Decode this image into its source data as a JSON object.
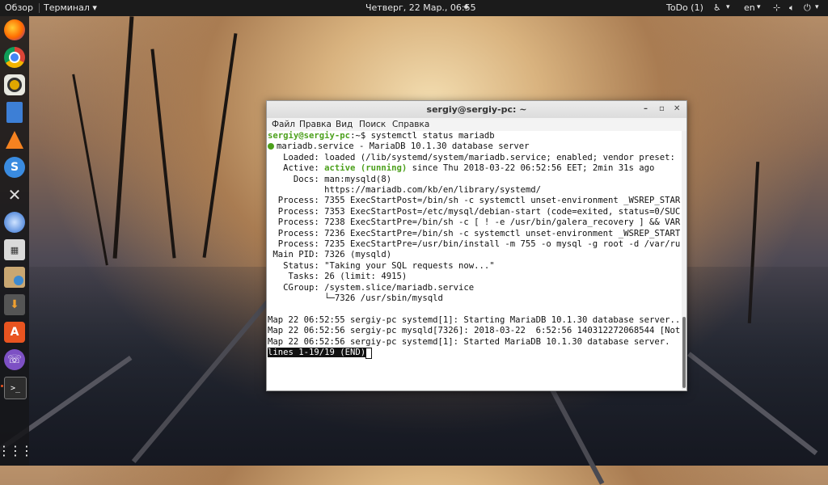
{
  "topbar": {
    "overview": "Обзор",
    "app_menu": "Терминал ▾",
    "clock": "Четверг, 22 Мар., 06:55",
    "todo": "ToDo (1)",
    "lang": "en",
    "lang_arrow": "▾",
    "accessibility_arrow": "▾",
    "net_arrow": "▾",
    "power_arrow": "▾"
  },
  "dock": {
    "icons": [
      "firefox-icon",
      "chrome-icon",
      "rhythmbox-icon",
      "text-editor-icon",
      "vlc-icon",
      "simplenote-icon",
      "tools-icon",
      "thunderbird-icon",
      "calculator-icon",
      "file-manager-icon",
      "installer-icon",
      "app-center-icon",
      "viber-icon",
      "terminal-icon",
      "show-apps-icon"
    ]
  },
  "window": {
    "title": "sergiy@sergiy-pc: ~",
    "menu": [
      "Файл",
      "Правка",
      "Вид",
      "Поиск",
      "Справка"
    ]
  },
  "terminal": {
    "prompt_user": "sergiy@sergiy-pc",
    "prompt_path": ":~$ ",
    "command": "systemctl status mariadb",
    "service_line": "mariadb.service - MariaDB 10.1.30 database server",
    "loaded": "   Loaded: loaded (/lib/systemd/system/mariadb.service; enabled; vendor preset:",
    "active_label": "   Active: ",
    "active_status": "active (running)",
    "active_rest": " since Thu 2018-03-22 06:52:56 EET; 2min 31s ago",
    "docs": "     Docs: man:mysqld(8)",
    "docs2": "           https://mariadb.com/kb/en/library/systemd/",
    "process_lines": [
      "  Process: 7355 ExecStartPost=/bin/sh -c systemctl unset-environment _WSREP_STAR",
      "  Process: 7353 ExecStartPost=/etc/mysql/debian-start (code=exited, status=0/SUC",
      "  Process: 7238 ExecStartPre=/bin/sh -c [ ! -e /usr/bin/galera_recovery ] && VAR",
      "  Process: 7236 ExecStartPre=/bin/sh -c systemctl unset-environment _WSREP_START",
      "  Process: 7235 ExecStartPre=/usr/bin/install -m 755 -o mysql -g root -d /var/ru"
    ],
    "main_pid": " Main PID: 7326 (mysqld)",
    "status": "   Status: \"Taking your SQL requests now...\"",
    "tasks": "    Tasks: 26 (limit: 4915)",
    "cgroup": "   CGroup: /system.slice/mariadb.service",
    "cgroup_child": "           └─7326 /usr/sbin/mysqld",
    "log_lines": [
      "Мар 22 06:52:55 sergiy-pc systemd[1]: Starting MariaDB 10.1.30 database server..",
      "Мар 22 06:52:56 sergiy-pc mysqld[7326]: 2018-03-22  6:52:56 140312272068544 [Not",
      "Мар 22 06:52:56 sergiy-pc systemd[1]: Started MariaDB 10.1.30 database server."
    ],
    "pager": "lines 1-19/19 (END)"
  },
  "colors": {
    "prompt_green": "#4ca01c",
    "active_green": "#4ca01c",
    "topbar_bg": "#1b1b1b"
  }
}
